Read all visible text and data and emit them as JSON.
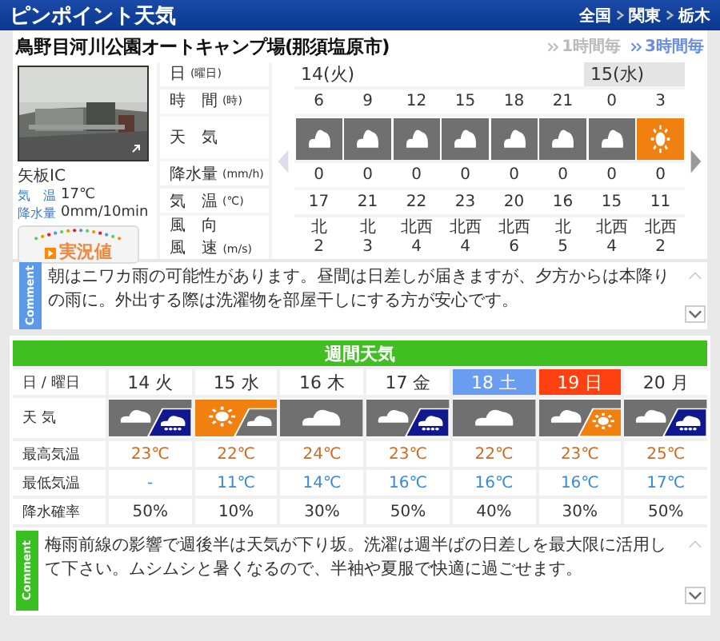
{
  "header": {
    "title": "ピンポイント天気",
    "breadcrumbs": [
      "全国",
      "関東",
      "栃木"
    ]
  },
  "location": {
    "name": "鳥野目河川公園オートキャンプ場(那須塩原市)",
    "intervals": [
      {
        "label": "1時間毎",
        "selected": false
      },
      {
        "label": "3時間毎",
        "selected": true
      }
    ]
  },
  "camera": {
    "name": "矢板IC",
    "temp_label": "気　温",
    "temp": "17℃",
    "precip_label": "降水量",
    "precip": "0mm/10min",
    "button": "実況値"
  },
  "hourly": {
    "row_labels": [
      {
        "main": "日",
        "unit": "(曜日)"
      },
      {
        "main": "時　間",
        "unit": "(時)"
      },
      {
        "main": "天　気"
      },
      {
        "main": "降水量",
        "unit": "(mm/h)"
      },
      {
        "main": "気　温",
        "unit": "(℃)"
      },
      {
        "main": "風　向"
      },
      {
        "main": "風　速",
        "unit": "(m/s)"
      }
    ],
    "days": [
      {
        "label": "14(火)",
        "shaded": false,
        "hours": [
          {
            "time": "6",
            "kind": "cloud",
            "precip": "0",
            "temp": "17",
            "wind_dir": "北",
            "wind_speed": "2"
          },
          {
            "time": "9",
            "kind": "cloud",
            "precip": "0",
            "temp": "21",
            "wind_dir": "北",
            "wind_speed": "3"
          },
          {
            "time": "12",
            "kind": "cloud",
            "precip": "0",
            "temp": "22",
            "wind_dir": "北西",
            "wind_speed": "4"
          },
          {
            "time": "15",
            "kind": "cloud",
            "precip": "0",
            "temp": "23",
            "wind_dir": "北西",
            "wind_speed": "4"
          },
          {
            "time": "18",
            "kind": "cloud",
            "precip": "0",
            "temp": "20",
            "wind_dir": "北西",
            "wind_speed": "6"
          },
          {
            "time": "21",
            "kind": "cloud",
            "precip": "0",
            "temp": "16",
            "wind_dir": "北",
            "wind_speed": "5"
          }
        ]
      },
      {
        "label": "15(水)",
        "shaded": true,
        "hours": [
          {
            "time": "0",
            "kind": "cloud",
            "precip": "0",
            "temp": "15",
            "wind_dir": "北西",
            "wind_speed": "4"
          },
          {
            "time": "3",
            "kind": "sun",
            "precip": "0",
            "temp": "11",
            "wind_dir": "北西",
            "wind_speed": "2"
          }
        ]
      }
    ]
  },
  "comment": {
    "tab": "Comment",
    "text": "朝はニワカ雨の可能性があります。昼間は日差しが届きますが、夕方からは本降りの雨に。外出する際は洗濯物を部屋干しにする方が安心です。"
  },
  "weekly": {
    "title": "週間天気",
    "row_labels": [
      "日 / 曜日",
      "天 気",
      "最高気温",
      "最低気温",
      "降水確率"
    ],
    "days": [
      {
        "label": "14 火",
        "kind": "weekday",
        "weather": [
          {
            "kind": "cloud"
          },
          {
            "kind": "rain"
          }
        ],
        "high": "23℃",
        "low": "-",
        "rain": "50%"
      },
      {
        "label": "15 水",
        "kind": "weekday",
        "weather": [
          {
            "kind": "sun"
          },
          {
            "kind": "cloud"
          }
        ],
        "high": "22℃",
        "low": "11℃",
        "rain": "10%"
      },
      {
        "label": "16 木",
        "kind": "weekday",
        "weather": [
          {
            "kind": "cloud"
          }
        ],
        "high": "24℃",
        "low": "14℃",
        "rain": "30%"
      },
      {
        "label": "17 金",
        "kind": "weekday",
        "weather": [
          {
            "kind": "cloud"
          },
          {
            "kind": "rain"
          }
        ],
        "high": "23℃",
        "low": "16℃",
        "rain": "50%"
      },
      {
        "label": "18 土",
        "kind": "saturday",
        "weather": [
          {
            "kind": "cloud"
          }
        ],
        "high": "22℃",
        "low": "16℃",
        "rain": "40%"
      },
      {
        "label": "19 日",
        "kind": "sunday",
        "weather": [
          {
            "kind": "cloud"
          },
          {
            "kind": "sun"
          }
        ],
        "high": "23℃",
        "low": "16℃",
        "rain": "30%"
      },
      {
        "label": "20 月",
        "kind": "weekday",
        "weather": [
          {
            "kind": "cloud"
          },
          {
            "kind": "rain"
          }
        ],
        "high": "25℃",
        "low": "17℃",
        "rain": "50%"
      }
    ],
    "comment": {
      "tab": "Comment",
      "text": "梅雨前線の影響で週後半は天気が下り坂。洗濯は週半ばの日差しを最大限に活用して下さい。ムシムシと暑くなるので、半袖や夏服で快適に過ごせます。"
    }
  }
}
